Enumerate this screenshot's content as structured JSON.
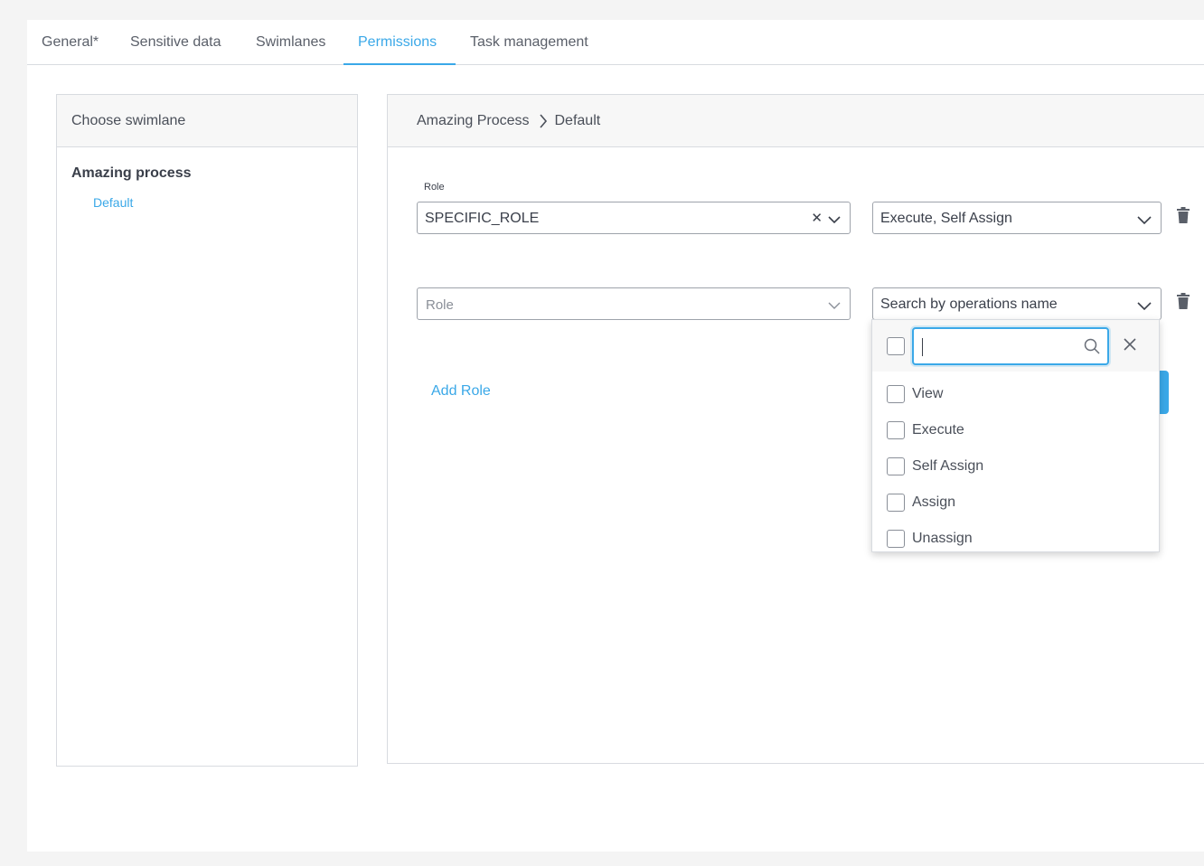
{
  "tabs": [
    {
      "label": "General*"
    },
    {
      "label": "Sensitive data"
    },
    {
      "label": "Swimlanes"
    },
    {
      "label": "Permissions"
    },
    {
      "label": "Task management"
    }
  ],
  "active_tab": "Permissions",
  "left_panel": {
    "header": "Choose swimlane",
    "process_name": "Amazing process",
    "swimlane_item": "Default"
  },
  "right_panel": {
    "breadcrumb": [
      "Amazing Process",
      "Default"
    ],
    "role_label": "Role",
    "rows": [
      {
        "role_value": "SPECIFIC_ROLE",
        "operations_value": "Execute, Self Assign"
      },
      {
        "role_placeholder": "Role",
        "operations_placeholder": "Search by operations name"
      }
    ],
    "add_role_label": "Add Role"
  },
  "dropdown": {
    "search_value": "",
    "options": [
      "View",
      "Execute",
      "Self Assign",
      "Assign",
      "Unassign"
    ]
  },
  "icons": {
    "chevron": "chevron-down-icon",
    "clear": "clear-icon",
    "trash": "trash-icon",
    "search": "search-icon",
    "close": "close-icon",
    "breadcrumb_separator": "chevron-right-icon"
  },
  "colors": {
    "accent": "#3aa8e8",
    "text": "#3a3f4a",
    "border": "#d8dbe0"
  }
}
